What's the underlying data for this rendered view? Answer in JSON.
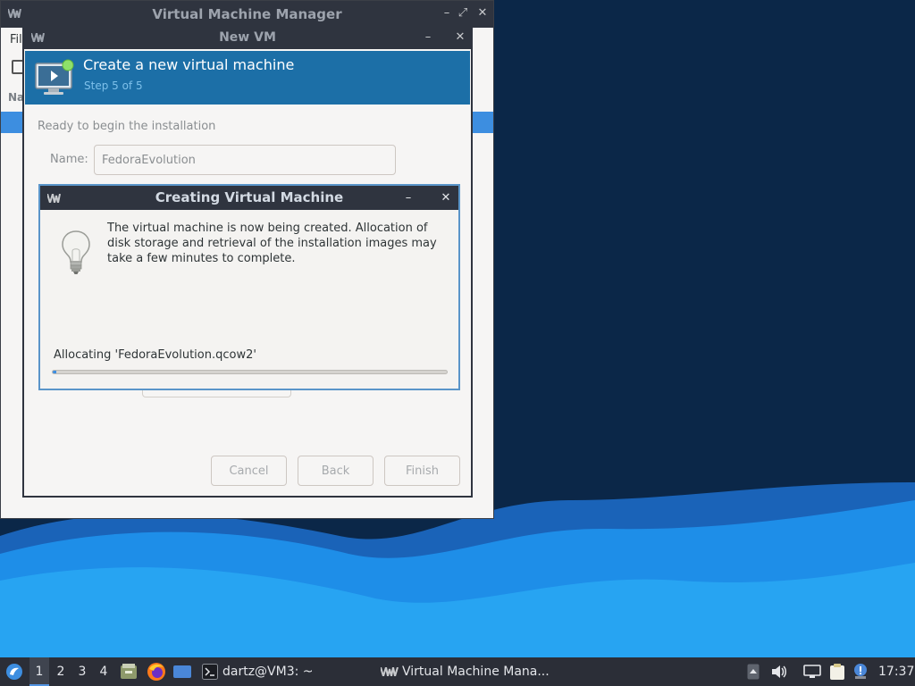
{
  "vmm_window": {
    "title": "Virtual Machine Manager",
    "menu_file_peek": "Fil",
    "list_header_peek": "Na",
    "controls": {
      "minimize": "–",
      "maximize": "⤢",
      "close": "✕"
    }
  },
  "newvm_window": {
    "title": "New VM",
    "controls": {
      "minimize": "–",
      "close": "✕"
    },
    "header_title": "Create a new virtual machine",
    "header_step": "Step 5 of 5",
    "ready_label": "Ready to begin the installation",
    "name_label": "Name:",
    "name_value": "FedoraEvolution",
    "buttons": {
      "cancel": "Cancel",
      "back": "Back",
      "finish": "Finish"
    }
  },
  "creating_dialog": {
    "title": "Creating Virtual Machine",
    "controls": {
      "minimize": "–",
      "close": "✕"
    },
    "message": "The virtual machine is now being created. Allocation of disk storage and retrieval of the installation images may take a few minutes to complete.",
    "allocating_text": "Allocating 'FedoraEvolution.qcow2'",
    "progress": 0.01
  },
  "taskbar": {
    "workspaces": [
      "1",
      "2",
      "3",
      "4"
    ],
    "active_workspace": "1",
    "terminal_task": "dartz@VM3: ~",
    "vmm_task": "Virtual Machine Mana...",
    "clock": "17:37"
  },
  "colors": {
    "titlebar": "#2f343f",
    "wizard_header": "#1c6fa7",
    "accent": "#3d8ee0",
    "taskbar": "#2b2e37"
  }
}
